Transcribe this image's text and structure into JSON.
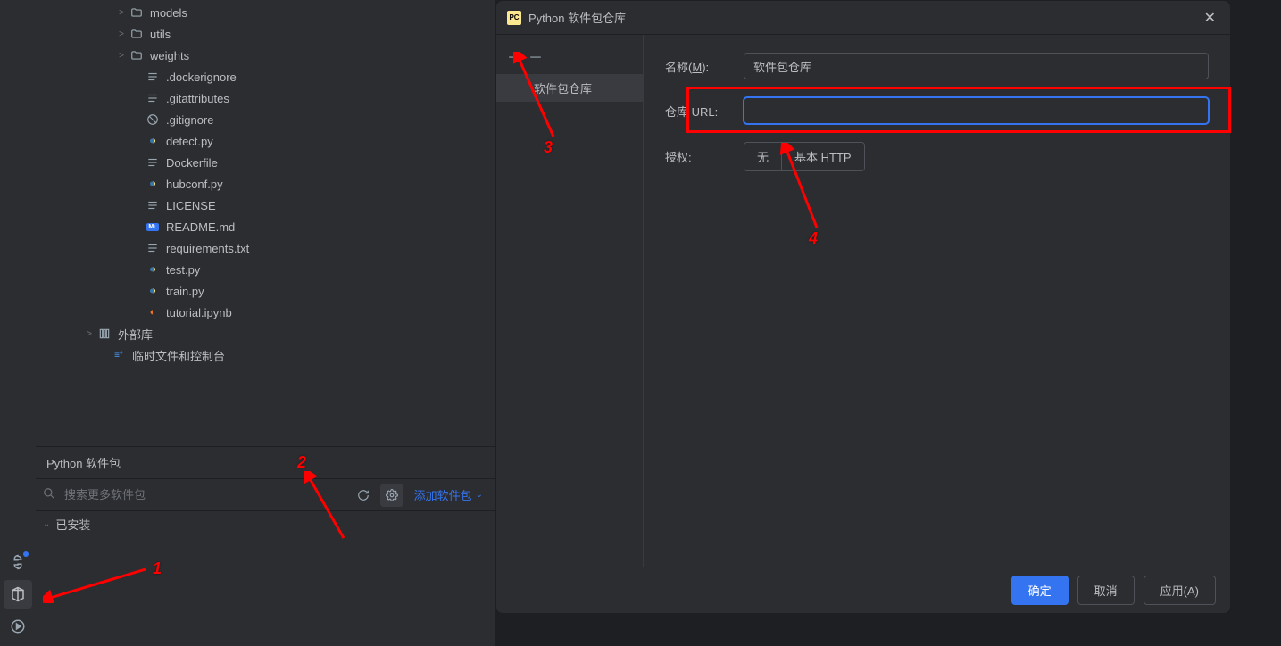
{
  "tree": {
    "items": [
      {
        "indent": 88,
        "chevron": ">",
        "icon": "folder",
        "label": "models"
      },
      {
        "indent": 88,
        "chevron": ">",
        "icon": "folder",
        "label": "utils"
      },
      {
        "indent": 88,
        "chevron": ">",
        "icon": "folder",
        "label": "weights"
      },
      {
        "indent": 106,
        "chevron": "",
        "icon": "txt",
        "label": ".dockerignore"
      },
      {
        "indent": 106,
        "chevron": "",
        "icon": "txt",
        "label": ".gitattributes"
      },
      {
        "indent": 106,
        "chevron": "",
        "icon": "ignore",
        "label": ".gitignore"
      },
      {
        "indent": 106,
        "chevron": "",
        "icon": "py",
        "label": "detect.py"
      },
      {
        "indent": 106,
        "chevron": "",
        "icon": "txt",
        "label": "Dockerfile"
      },
      {
        "indent": 106,
        "chevron": "",
        "icon": "py",
        "label": "hubconf.py"
      },
      {
        "indent": 106,
        "chevron": "",
        "icon": "txt",
        "label": "LICENSE"
      },
      {
        "indent": 106,
        "chevron": "",
        "icon": "md",
        "label": "README.md"
      },
      {
        "indent": 106,
        "chevron": "",
        "icon": "txt",
        "label": "requirements.txt"
      },
      {
        "indent": 106,
        "chevron": "",
        "icon": "py",
        "label": "test.py"
      },
      {
        "indent": 106,
        "chevron": "",
        "icon": "py",
        "label": "train.py"
      },
      {
        "indent": 106,
        "chevron": "",
        "icon": "jupyter",
        "label": "tutorial.ipynb"
      },
      {
        "indent": 52,
        "chevron": ">",
        "icon": "lib",
        "label": "外部库"
      },
      {
        "indent": 68,
        "chevron": "",
        "icon": "scratch",
        "label": "临时文件和控制台"
      }
    ]
  },
  "packages": {
    "title": "Python 软件包",
    "search_placeholder": "搜索更多软件包",
    "add_package": "添加软件包",
    "installed": "已安装"
  },
  "dialog": {
    "title": "Python 软件包仓库",
    "repo_item": "软件包仓库",
    "name_label": "名称(",
    "name_mnemonic": "M",
    "name_label_end": "):",
    "name_value": "软件包仓库",
    "url_label": "仓库 URL:",
    "url_value": "",
    "auth_label": "授权:",
    "auth_none": "无",
    "auth_basic": "基本 HTTP",
    "ok": "确定",
    "cancel": "取消",
    "apply": "应用(A)"
  },
  "annotations": {
    "n1": "1",
    "n2": "2",
    "n3": "3",
    "n4": "4"
  }
}
